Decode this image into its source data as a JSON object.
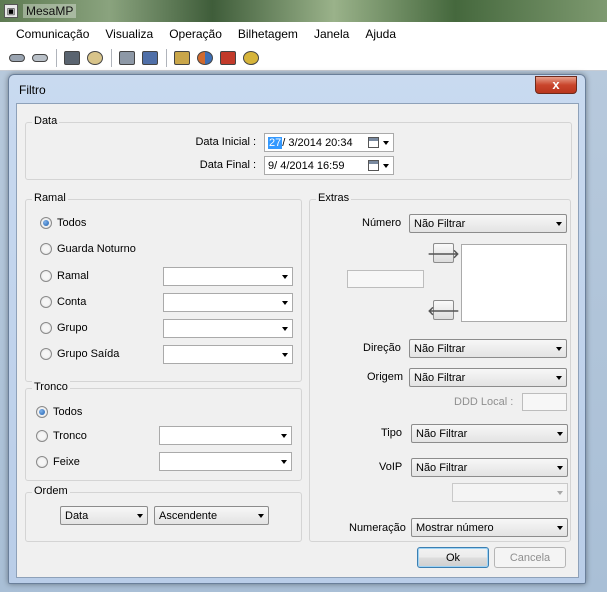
{
  "app": {
    "title": "MesaMP"
  },
  "menu": [
    "Comunicação",
    "Visualiza",
    "Operação",
    "Bilhetagem",
    "Janela",
    "Ajuda"
  ],
  "toolbar": {
    "icons": [
      "connect-icon",
      "disconnect-icon",
      "terminal-icon",
      "settings-icon",
      "tools-icon",
      "module-icon",
      "report-icon",
      "users-icon",
      "alarm-icon",
      "wrench-icon"
    ]
  },
  "dialog": {
    "title": "Filtro",
    "close_label": "x",
    "data_group": {
      "label": "Data",
      "inicial_label": "Data Inicial :",
      "inicial_selected": "27",
      "inicial_rest": "/ 3/2014 20:34",
      "final_label": "Data Final :",
      "final_value": "9/ 4/2014 16:59"
    },
    "ramal_group": {
      "label": "Ramal",
      "options": [
        "Todos",
        "Guarda Noturno",
        "Ramal",
        "Conta",
        "Grupo",
        "Grupo Saída"
      ],
      "selected": "Todos"
    },
    "tronco_group": {
      "label": "Tronco",
      "options": [
        "Todos",
        "Tronco",
        "Feixe"
      ],
      "selected": "Todos"
    },
    "ordem_group": {
      "label": "Ordem",
      "field": "Data",
      "direction": "Ascendente"
    },
    "extras_group": {
      "label": "Extras",
      "numero_label": "Número",
      "numero_value": "Não Filtrar",
      "move_right": "🡒",
      "move_left": "🡐",
      "direcao_label": "Direção",
      "direcao_value": "Não Filtrar",
      "origem_label": "Origem",
      "origem_value": "Não Filtrar",
      "ddd_label": "DDD Local :",
      "tipo_label": "Tipo",
      "tipo_value": "Não Filtrar",
      "voip_label": "VoIP",
      "voip_value": "Não Filtrar",
      "numeracao_label": "Numeração",
      "numeracao_value": "Mostrar número"
    },
    "ok_label": "Ok",
    "cancel_label": "Cancela"
  },
  "colors": {
    "dialog_frame": "#c9daf0",
    "client_bg": "#f0f0f0",
    "selection": "#3399ff",
    "close_button": "#c9452c"
  }
}
